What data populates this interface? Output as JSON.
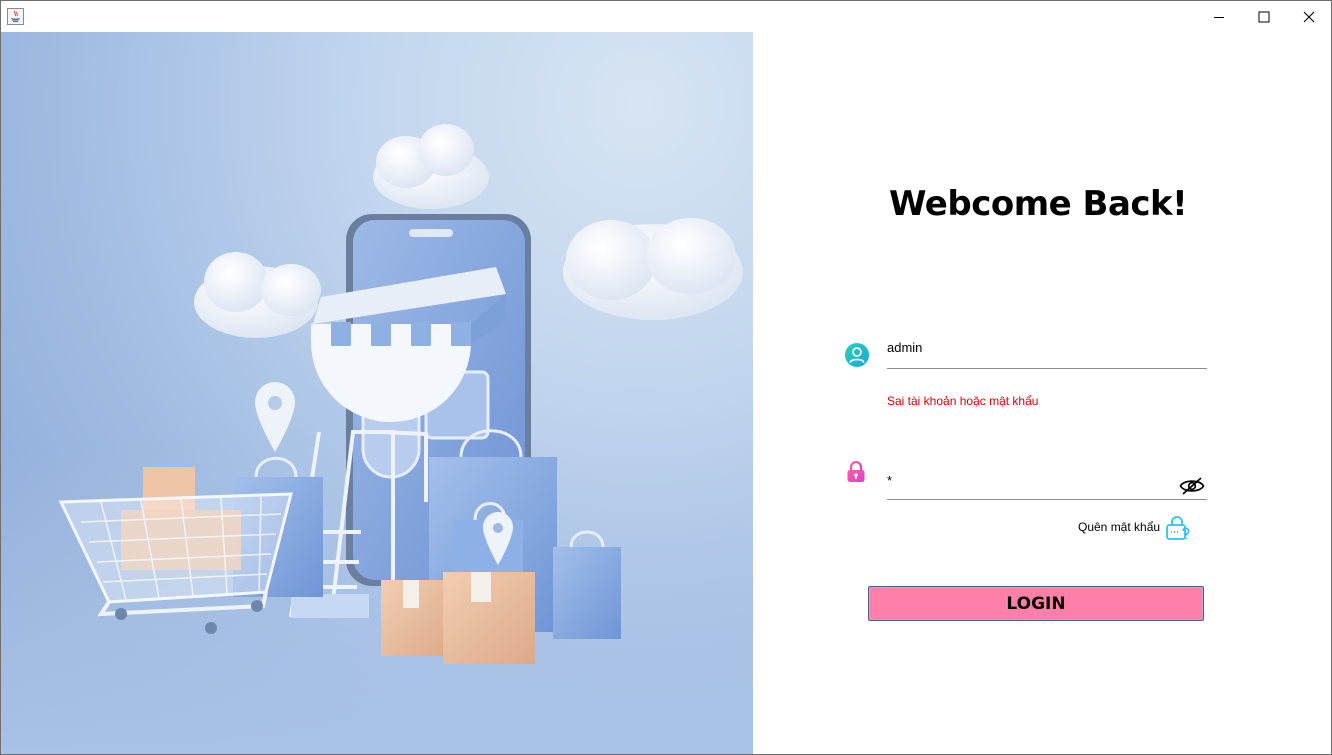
{
  "window": {
    "title": "",
    "controls": {
      "minimize": "minimize-icon",
      "maximize": "maximize-icon",
      "close": "close-icon"
    }
  },
  "hero": {
    "image": "online-shopping-illustration"
  },
  "login": {
    "heading": "Webcome Back!",
    "username": {
      "value": "admin",
      "icon": "user-icon"
    },
    "error_message": "Sai tài khoản hoặc mật khẩu",
    "password": {
      "value": "*",
      "icon": "lock-icon",
      "toggle_icon": "eye-off-icon"
    },
    "forgot_label": "Quên mật khẩu",
    "forgot_icon": "lock-question-icon",
    "login_button": "LOGIN"
  },
  "colors": {
    "accent_button": "#ff7fab",
    "error_text": "#e00000",
    "user_icon": "#1ec8c8",
    "lock_icon": "#f0409a",
    "forgot_icon": "#29c3f0"
  }
}
